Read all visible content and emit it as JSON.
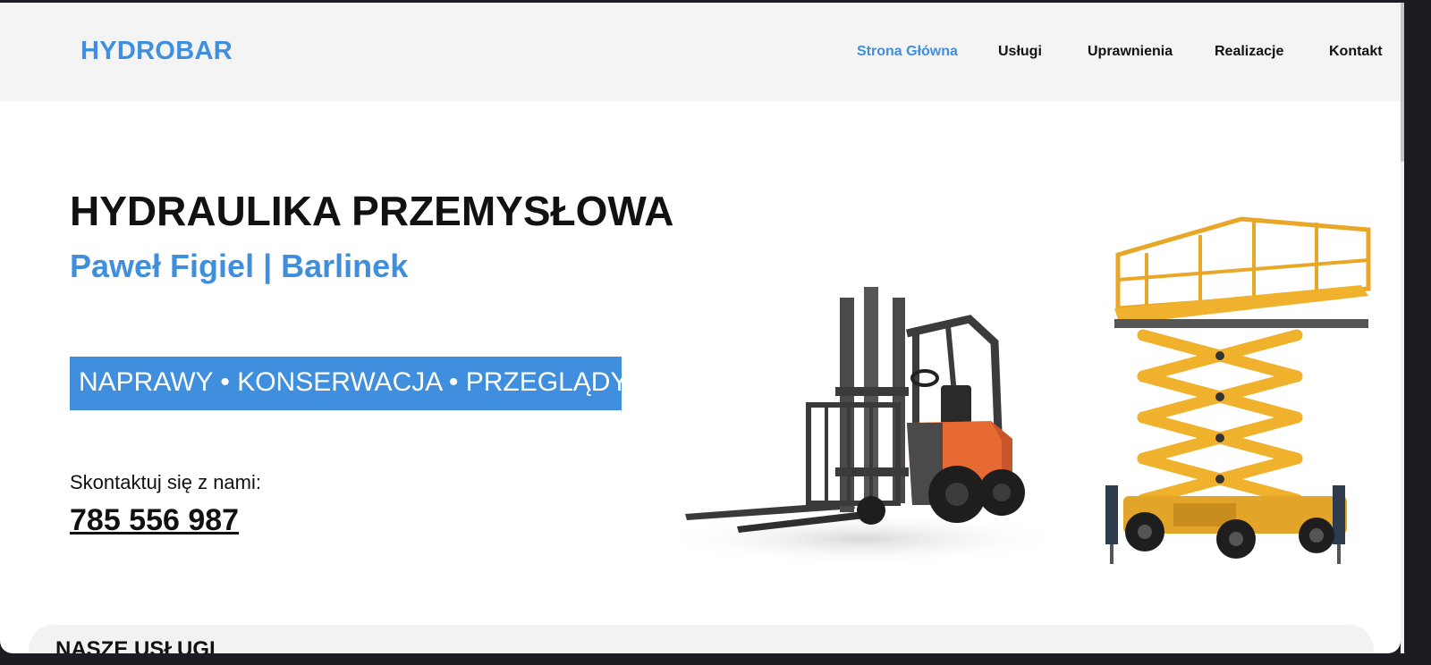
{
  "header": {
    "logo": "HYDROBAR",
    "nav": [
      {
        "label": "Strona Główna",
        "active": true
      },
      {
        "label": "Usługi",
        "active": false
      },
      {
        "label": "Uprawnienia",
        "active": false
      },
      {
        "label": "Realizacje",
        "active": false
      },
      {
        "label": "Kontakt",
        "active": false
      }
    ]
  },
  "hero": {
    "title": "HYDRAULIKA PRZEMYSŁOWA",
    "subtitle": "Paweł Figiel | Barlinek",
    "services_banner": "NAPRAWY • KONSERWACJA • PRZEGLĄDY",
    "contact_prompt": "Skontaktuj się z nami:",
    "phone": "785 556 987"
  },
  "sections": {
    "services_heading": "NASZE USŁUGI"
  },
  "colors": {
    "accent": "#3f8fde",
    "header_bg": "#f4f4f4",
    "card_bg": "#f2f2f2",
    "forklift_body": "#e86a33",
    "lift_yellow": "#f0b12c"
  }
}
